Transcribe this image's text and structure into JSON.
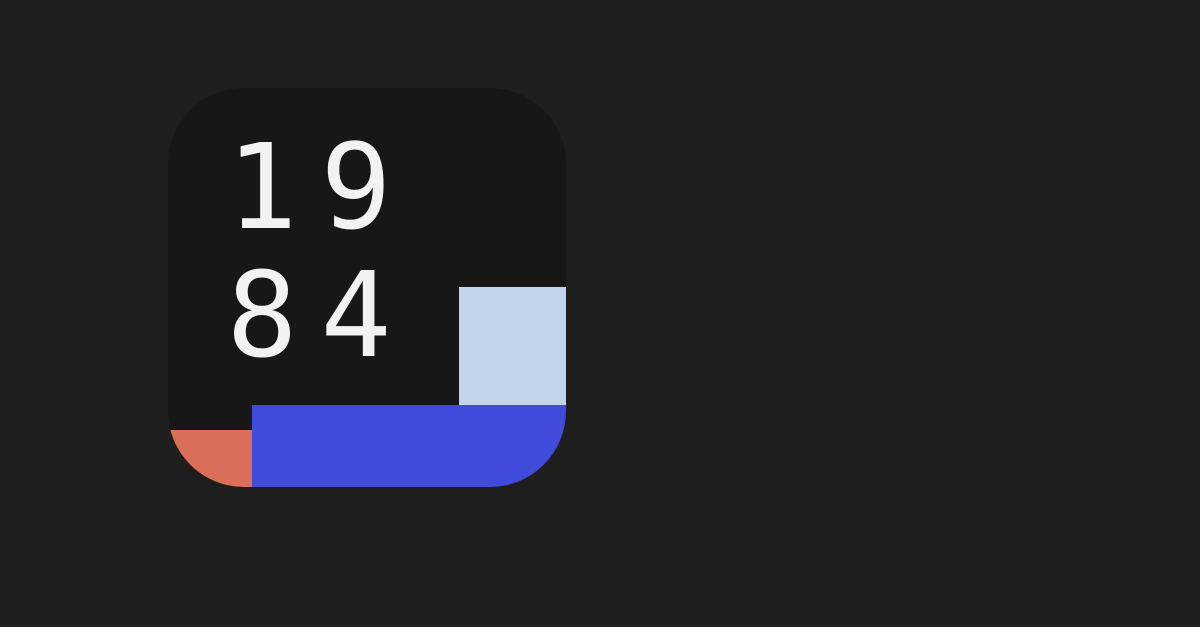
{
  "logo": {
    "digits": [
      "1",
      "9",
      "8",
      "4"
    ],
    "colors": {
      "background": "#1e1e1e",
      "tile": "#171717",
      "text": "#f2f2f2",
      "light_block": "#c3d3ec",
      "blue_block": "#404bdb",
      "orange_block": "#db6e58"
    }
  }
}
